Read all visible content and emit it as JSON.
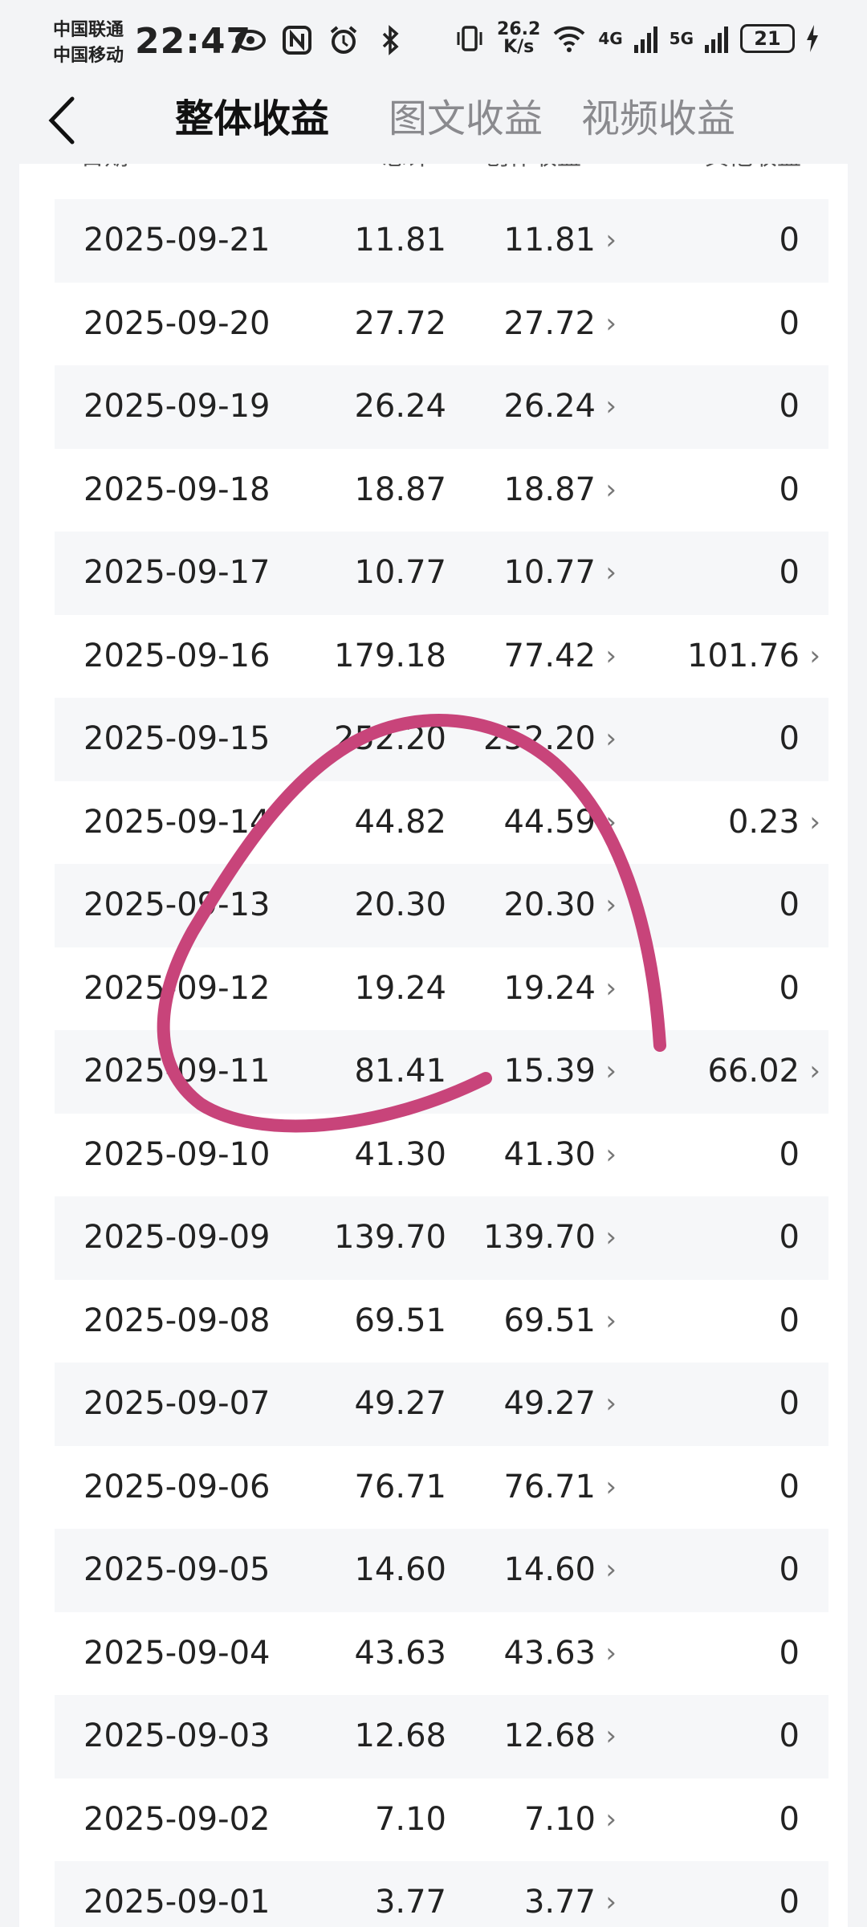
{
  "status_bar": {
    "carrier1": "中国联通",
    "carrier2": "中国移动",
    "time": "22:47",
    "net_speed_value": "26.2",
    "net_speed_unit": "K/s",
    "net1": "4G",
    "net2": "5G",
    "battery": "21"
  },
  "header": {
    "tabs": [
      {
        "label": "整体收益",
        "active": true
      },
      {
        "label": "图文收益",
        "active": false
      },
      {
        "label": "视频收益",
        "active": false
      }
    ]
  },
  "table": {
    "columns": [
      "日期",
      "总计",
      "创作收益",
      "其他收益"
    ],
    "rows": [
      {
        "date": "2025-09-21",
        "total": "11.81",
        "creation": "11.81",
        "other": "0"
      },
      {
        "date": "2025-09-20",
        "total": "27.72",
        "creation": "27.72",
        "other": "0"
      },
      {
        "date": "2025-09-19",
        "total": "26.24",
        "creation": "26.24",
        "other": "0"
      },
      {
        "date": "2025-09-18",
        "total": "18.87",
        "creation": "18.87",
        "other": "0"
      },
      {
        "date": "2025-09-17",
        "total": "10.77",
        "creation": "10.77",
        "other": "0"
      },
      {
        "date": "2025-09-16",
        "total": "179.18",
        "creation": "77.42",
        "other": "101.76"
      },
      {
        "date": "2025-09-15",
        "total": "252.20",
        "creation": "252.20",
        "other": "0"
      },
      {
        "date": "2025-09-14",
        "total": "44.82",
        "creation": "44.59",
        "other": "0.23"
      },
      {
        "date": "2025-09-13",
        "total": "20.30",
        "creation": "20.30",
        "other": "0"
      },
      {
        "date": "2025-09-12",
        "total": "19.24",
        "creation": "19.24",
        "other": "0"
      },
      {
        "date": "2025-09-11",
        "total": "81.41",
        "creation": "15.39",
        "other": "66.02"
      },
      {
        "date": "2025-09-10",
        "total": "41.30",
        "creation": "41.30",
        "other": "0"
      },
      {
        "date": "2025-09-09",
        "total": "139.70",
        "creation": "139.70",
        "other": "0"
      },
      {
        "date": "2025-09-08",
        "total": "69.51",
        "creation": "69.51",
        "other": "0"
      },
      {
        "date": "2025-09-07",
        "total": "49.27",
        "creation": "49.27",
        "other": "0"
      },
      {
        "date": "2025-09-06",
        "total": "76.71",
        "creation": "76.71",
        "other": "0"
      },
      {
        "date": "2025-09-05",
        "total": "14.60",
        "creation": "14.60",
        "other": "0"
      },
      {
        "date": "2025-09-04",
        "total": "43.63",
        "creation": "43.63",
        "other": "0"
      },
      {
        "date": "2025-09-03",
        "total": "12.68",
        "creation": "12.68",
        "other": "0"
      },
      {
        "date": "2025-09-02",
        "total": "7.10",
        "creation": "7.10",
        "other": "0"
      },
      {
        "date": "2025-09-01",
        "total": "3.77",
        "creation": "3.77",
        "other": "0"
      }
    ]
  },
  "annotation": {
    "color": "#c8447a"
  }
}
